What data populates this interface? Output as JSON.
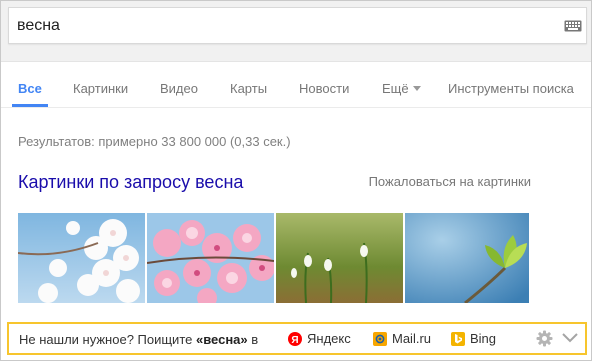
{
  "search": {
    "query": "весна",
    "keyboard_icon": "keyboard-icon"
  },
  "tabs": [
    {
      "label": "Все",
      "active": true
    },
    {
      "label": "Картинки"
    },
    {
      "label": "Видео"
    },
    {
      "label": "Карты"
    },
    {
      "label": "Новости"
    },
    {
      "label": "Ещё"
    },
    {
      "label": "Инструменты поиска"
    }
  ],
  "results": {
    "count_text": "Результатов: примерно 33 800 000 (0,33 сек.)"
  },
  "images": {
    "heading": "Картинки по запросу весна",
    "report_link": "Пожаловаться на картинки"
  },
  "bottom_bar": {
    "prefix": "Не нашли нужное? Поищите ",
    "query": "«весна»",
    "suffix": " в",
    "engines": [
      {
        "label": "Яндекс",
        "icon": "yandex-logo-icon",
        "color": "#ff0000"
      },
      {
        "label": "Mail.ru",
        "icon": "mailru-logo-icon",
        "color": "#f7a600"
      },
      {
        "label": "Bing",
        "icon": "bing-logo-icon",
        "color": "#f4b400"
      }
    ],
    "border_color": "#f7c52d"
  },
  "colors": {
    "active_tab": "#4285f4",
    "link": "#1a0dab"
  }
}
